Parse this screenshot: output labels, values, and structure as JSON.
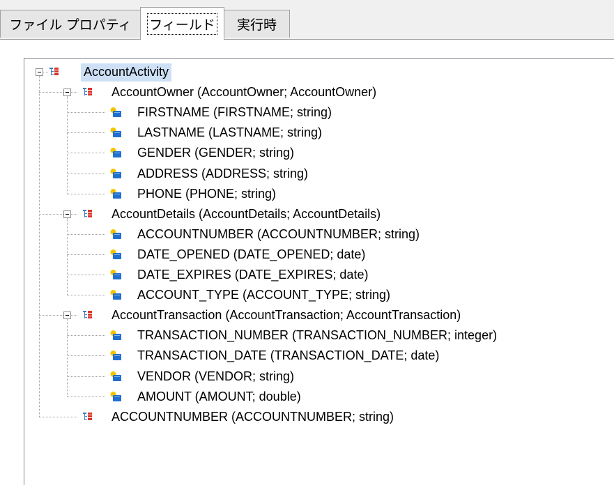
{
  "tabs": {
    "file_properties": "ファイル プロパティ",
    "fields": "フィールド",
    "runtime": "実行時"
  },
  "tree": {
    "root": "AccountActivity",
    "groups": [
      {
        "label": "AccountOwner (AccountOwner; AccountOwner)",
        "fields": [
          "FIRSTNAME (FIRSTNAME; string)",
          "LASTNAME (LASTNAME; string)",
          "GENDER (GENDER; string)",
          "ADDRESS (ADDRESS; string)",
          "PHONE (PHONE; string)"
        ]
      },
      {
        "label": "AccountDetails (AccountDetails; AccountDetails)",
        "fields": [
          "ACCOUNTNUMBER (ACCOUNTNUMBER; string)",
          "DATE_OPENED (DATE_OPENED; date)",
          "DATE_EXPIRES (DATE_EXPIRES; date)",
          "ACCOUNT_TYPE (ACCOUNT_TYPE; string)"
        ]
      },
      {
        "label": "AccountTransaction (AccountTransaction; AccountTransaction)",
        "fields": [
          "TRANSACTION_NUMBER (TRANSACTION_NUMBER; integer)",
          "TRANSACTION_DATE (TRANSACTION_DATE; date)",
          "VENDOR (VENDOR; string)",
          "AMOUNT (AMOUNT; double)"
        ]
      }
    ],
    "last": "ACCOUNTNUMBER (ACCOUNTNUMBER; string)"
  },
  "icons": {
    "group": "structure-icon",
    "field": "field-icon"
  },
  "colors": {
    "selection": "#cde0f5",
    "field_icon_yellow": "#f5c400",
    "field_icon_blue": "#1f6fd0",
    "group_icon_red": "#d9342b",
    "group_icon_blue": "#3f7fc8"
  }
}
